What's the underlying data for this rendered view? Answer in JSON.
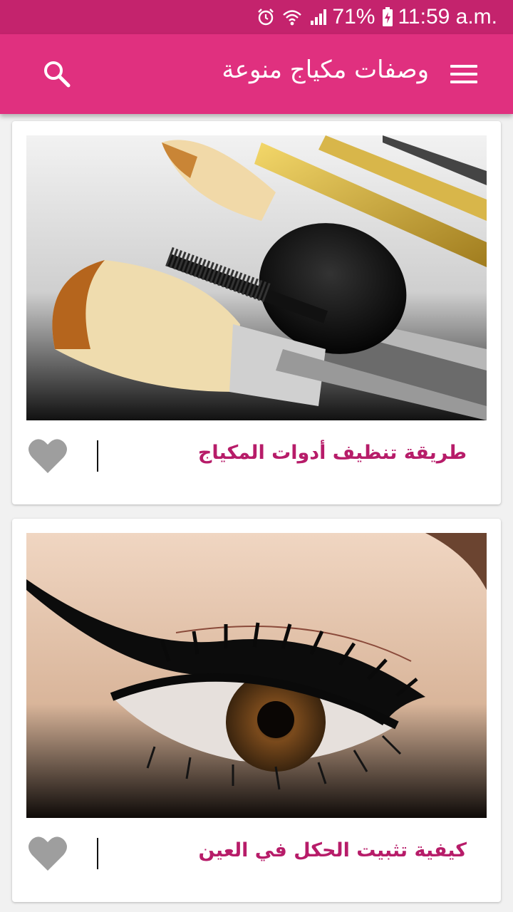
{
  "status_bar": {
    "battery": "71%",
    "time": "11:59 a.m.",
    "icons": [
      "alarm-icon",
      "wifi-icon",
      "signal-icon",
      "battery-charging-icon"
    ]
  },
  "app_bar": {
    "title": "وصفات مكياج منوعة",
    "icons": [
      "search-icon",
      "menu-icon"
    ]
  },
  "colors": {
    "status_bar": "#c4236d",
    "app_bar": "#e0307f",
    "card_title": "#b71c69",
    "heart": "#9e9e9e"
  },
  "cards": [
    {
      "title": "طريقة تنظيف أدوات المكياج",
      "image": "makeup-brushes-photo",
      "favorite": false
    },
    {
      "title": "كيفية تثبيت الحكل في العين",
      "image": "eyeliner-eye-photo",
      "favorite": false
    }
  ]
}
